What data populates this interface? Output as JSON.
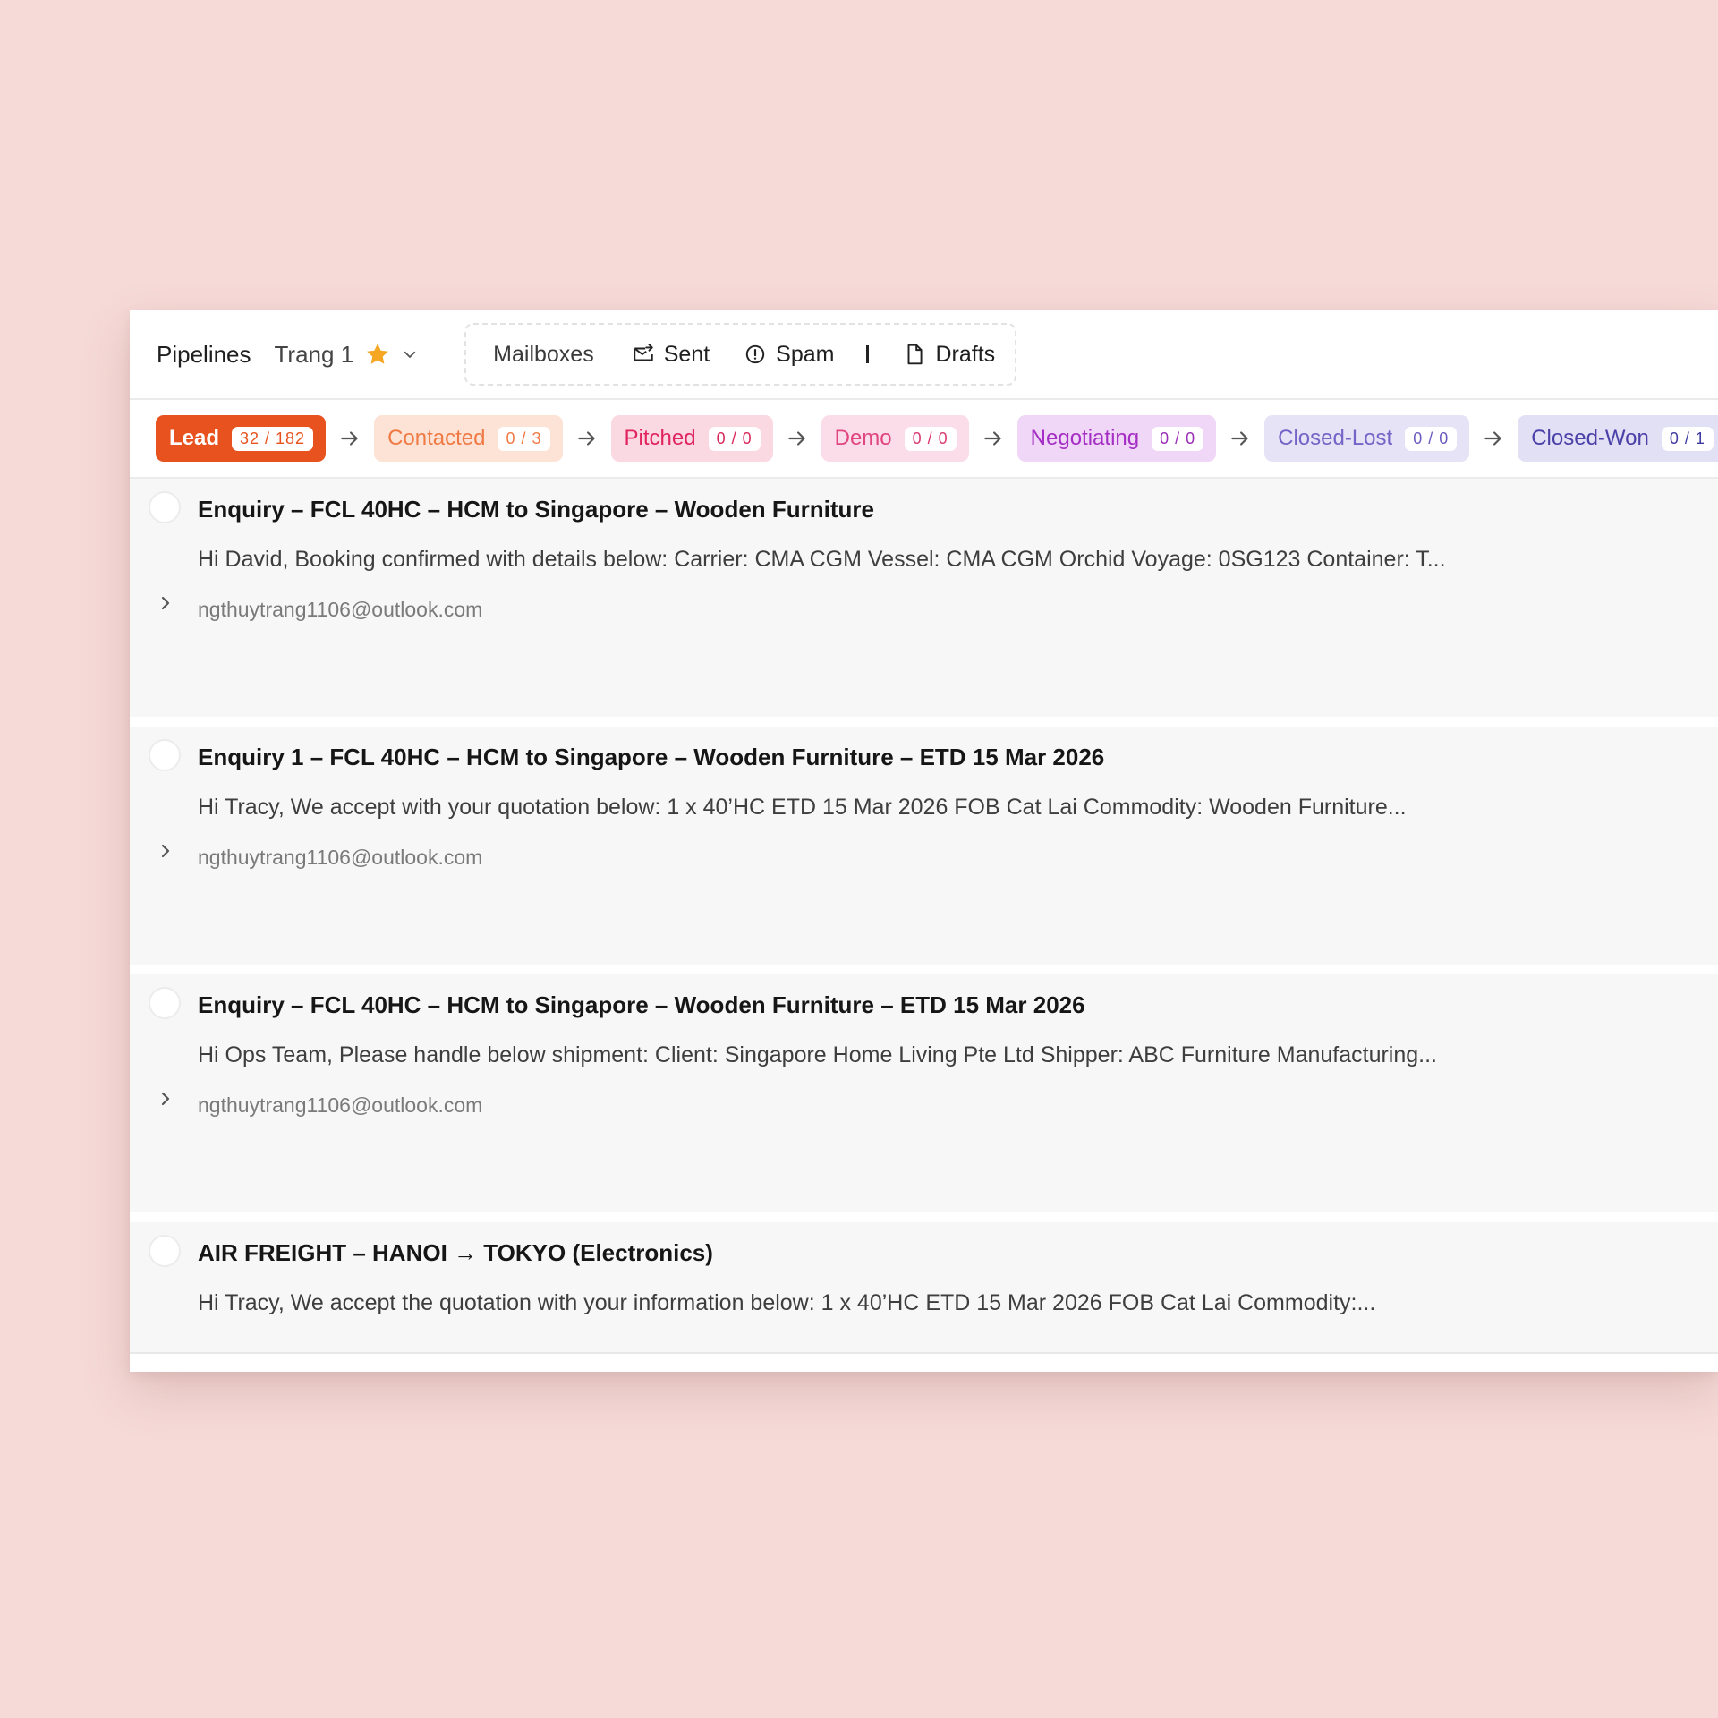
{
  "topbar": {
    "pipelines_label": "Pipelines",
    "workspace_name": "Trang 1",
    "star_icon": "star-icon",
    "star_color": "#f5a623",
    "mailboxes": {
      "label": "Mailboxes",
      "sent": "Sent",
      "spam": "Spam",
      "drafts": "Drafts"
    }
  },
  "stages": [
    {
      "label": "Lead",
      "count": "32 / 182"
    },
    {
      "label": "Contacted",
      "count": "0 / 3"
    },
    {
      "label": "Pitched",
      "count": "0 / 0"
    },
    {
      "label": "Demo",
      "count": "0 / 0"
    },
    {
      "label": "Negotiating",
      "count": "0 / 0"
    },
    {
      "label": "Closed-Lost",
      "count": "0 / 0"
    },
    {
      "label": "Closed-Won",
      "count": "0 / 1"
    }
  ],
  "emails": [
    {
      "subject": "Enquiry – FCL 40HC – HCM to Singapore – Wooden Furniture",
      "preview": "Hi David, Booking confirmed with details below: Carrier: CMA CGM Vessel: CMA CGM Orchid Voyage: 0SG123 Container: T...",
      "sender": "ngthuytrang1106@outlook.com"
    },
    {
      "subject": "Enquiry 1 – FCL 40HC – HCM to Singapore – Wooden Furniture – ETD 15 Mar 2026",
      "preview": "Hi Tracy, We accept with your quotation below: 1 x 40’HC ETD 15 Mar 2026 FOB Cat Lai Commodity: Wooden Furniture...",
      "sender": "ngthuytrang1106@outlook.com"
    },
    {
      "subject": "Enquiry – FCL 40HC – HCM to Singapore – Wooden Furniture – ETD 15 Mar 2026",
      "preview": "Hi Ops Team, Please handle below shipment: Client: Singapore Home Living Pte Ltd Shipper: ABC Furniture Manufacturing...",
      "sender": "ngthuytrang1106@outlook.com"
    },
    {
      "subject": "AIR FREIGHT – HANOI → TOKYO (Electronics)",
      "preview": "Hi Tracy, We accept the quotation with your information below: 1 x 40’HC ETD 15 Mar 2026 FOB Cat Lai Commodity:..."
    }
  ],
  "colors": {
    "background": "#f6dad7",
    "lead": "#e8521e",
    "contacted": "#f07a45",
    "pitched": "#e0245e",
    "demo": "#e0457e",
    "negotiating": "#a52fc4",
    "closed_lost": "#7564c7",
    "closed_won": "#4a41a8"
  }
}
